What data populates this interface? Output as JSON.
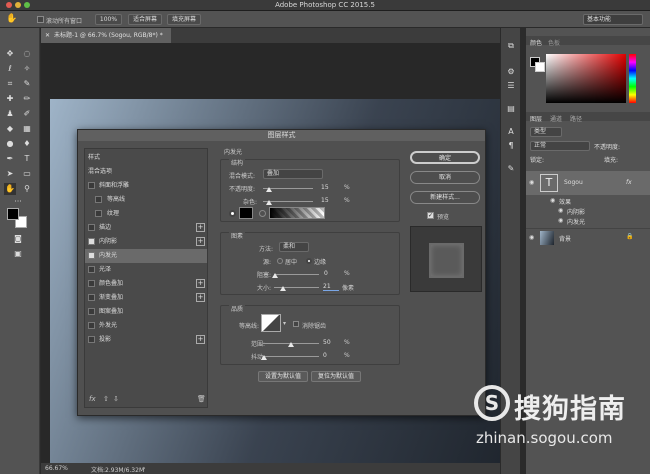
{
  "app": {
    "title": "Adobe Photoshop CC 2015.5"
  },
  "options": {
    "scroll_all": "滚动所有窗口",
    "zoom": "100%",
    "fit": "适合屏幕",
    "fill": "填充屏幕",
    "workspace": "基本功能"
  },
  "document": {
    "tab": "未标题-1 @ 66.7% (Sogou, RGB/8*) *",
    "zoom": "66.67%",
    "doc_info": "文档:2.93M/6.32M"
  },
  "panels": {
    "color_tab": "颜色",
    "swatches_tab": "色板",
    "layers_tab": "图层",
    "channels_tab": "通道",
    "paths_tab": "路径",
    "kind": "类型",
    "mode": "正常",
    "opacity_label": "不透明度:",
    "lock_label": "锁定:",
    "fill_label": "填充:"
  },
  "layers": {
    "text_layer": "Sogou",
    "effects": "效果",
    "inner_shadow": "内阴影",
    "inner_glow": "内发光",
    "background": "背景"
  },
  "dialog": {
    "title": "图层样式",
    "styles_header": "样式",
    "blend_options": "混合选项",
    "items": [
      "斜面和浮雕",
      "等高线",
      "纹理",
      "描边",
      "内阴影",
      "内发光",
      "光泽",
      "颜色叠加",
      "渐变叠加",
      "图案叠加",
      "外发光",
      "投影"
    ],
    "section_title": "内发光",
    "structure": "结构",
    "blend_mode_label": "混合模式:",
    "blend_mode": "叠加",
    "opacity_label": "不透明度:",
    "opacity_value": "15",
    "noise_label": "杂色:",
    "noise_value": "15",
    "percent": "%",
    "elements": "图素",
    "method_label": "方法:",
    "method": "柔和",
    "source_label": "源:",
    "center": "居中",
    "edge": "边缘",
    "choke_label": "阻塞:",
    "choke_value": "0",
    "size_label": "大小:",
    "size_value": "21",
    "px": "像素",
    "quality": "品质",
    "contour_label": "等高线:",
    "antialias": "消除锯齿",
    "range_label": "范围:",
    "range_value": "50",
    "jitter_label": "抖动:",
    "jitter_value": "0",
    "make_default": "设置为默认值",
    "reset_default": "复位为默认值",
    "ok": "确定",
    "cancel": "取消",
    "new_style": "新建样式...",
    "preview": "预览"
  },
  "watermark": {
    "brand": "搜狗指南",
    "url": "zhinan.sogou.com"
  },
  "colors": {
    "accent": "#2f66c8"
  }
}
